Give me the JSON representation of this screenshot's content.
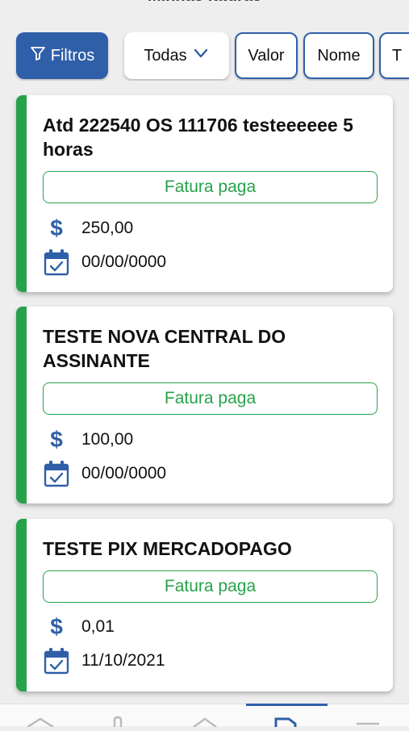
{
  "header": {
    "title": "Minhas faturas"
  },
  "filters": {
    "filtros_label": "Filtros",
    "todas_label": "Todas",
    "chips": [
      {
        "label": "Valor"
      },
      {
        "label": "Nome"
      },
      {
        "label": "T"
      }
    ]
  },
  "invoices": [
    {
      "title": "Atd 222540 OS 111706 testeeeeee 5 horas",
      "status": "Fatura paga",
      "amount": "250,00",
      "date": "00/00/0000"
    },
    {
      "title": "TESTE NOVA CENTRAL DO ASSINANTE",
      "status": "Fatura paga",
      "amount": "100,00",
      "date": "00/00/0000"
    },
    {
      "title": "TESTE PIX MERCADOPAGO",
      "status": "Fatura paga",
      "amount": "0,01",
      "date": "11/10/2021"
    }
  ],
  "bottom_nav": {
    "items": [
      {
        "icon": "home-icon"
      },
      {
        "icon": "wrench-icon"
      },
      {
        "icon": "house-outline-icon"
      },
      {
        "icon": "invoice-icon",
        "active": true
      },
      {
        "icon": "menu-icon"
      }
    ]
  },
  "colors": {
    "primary": "#2f5fa8",
    "paid": "#26a24b",
    "background": "#eeeeef"
  }
}
